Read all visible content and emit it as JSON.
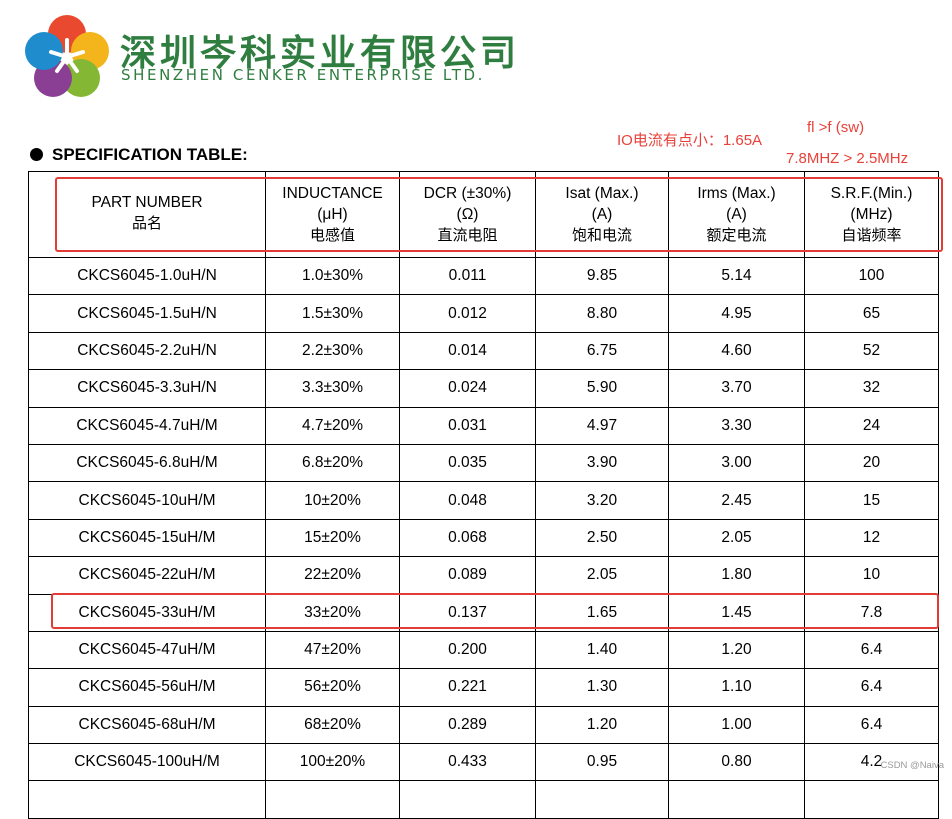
{
  "header": {
    "company_cn": "深圳岑科实业有限公司",
    "company_en": "SHENZHEN CENKER ENTERPRISE LTD."
  },
  "annotations": {
    "io_note": "IO电流有点小：1.65A",
    "freq_formula": "fl >f (sw)",
    "freq_compare": "7.8MHZ > 2.5MHz"
  },
  "spec_title": "SPECIFICATION TABLE:",
  "table": {
    "headers": [
      {
        "l1": "PART NUMBER",
        "l2": "",
        "cn": "品名"
      },
      {
        "l1": "INDUCTANCE",
        "l2": "(μH)",
        "cn": "电感值"
      },
      {
        "l1": "DCR (±30%)",
        "l2": "(Ω)",
        "cn": "直流电阻"
      },
      {
        "l1": "Isat (Max.)",
        "l2": "(A)",
        "cn": "饱和电流"
      },
      {
        "l1": "Irms (Max.)",
        "l2": "(A)",
        "cn": "额定电流"
      },
      {
        "l1": "S.R.F.(Min.)",
        "l2": "(MHz)",
        "cn": "自谐频率"
      }
    ],
    "rows": [
      [
        "CKCS6045-1.0uH/N",
        "1.0±30%",
        "0.011",
        "9.85",
        "5.14",
        "100"
      ],
      [
        "CKCS6045-1.5uH/N",
        "1.5±30%",
        "0.012",
        "8.80",
        "4.95",
        "65"
      ],
      [
        "CKCS6045-2.2uH/N",
        "2.2±30%",
        "0.014",
        "6.75",
        "4.60",
        "52"
      ],
      [
        "CKCS6045-3.3uH/N",
        "3.3±30%",
        "0.024",
        "5.90",
        "3.70",
        "32"
      ],
      [
        "CKCS6045-4.7uH/M",
        "4.7±20%",
        "0.031",
        "4.97",
        "3.30",
        "24"
      ],
      [
        "CKCS6045-6.8uH/M",
        "6.8±20%",
        "0.035",
        "3.90",
        "3.00",
        "20"
      ],
      [
        "CKCS6045-10uH/M",
        "10±20%",
        "0.048",
        "3.20",
        "2.45",
        "15"
      ],
      [
        "CKCS6045-15uH/M",
        "15±20%",
        "0.068",
        "2.50",
        "2.05",
        "12"
      ],
      [
        "CKCS6045-22uH/M",
        "22±20%",
        "0.089",
        "2.05",
        "1.80",
        "10"
      ],
      [
        "CKCS6045-33uH/M",
        "33±20%",
        "0.137",
        "1.65",
        "1.45",
        "7.8"
      ],
      [
        "CKCS6045-47uH/M",
        "47±20%",
        "0.200",
        "1.40",
        "1.20",
        "6.4"
      ],
      [
        "CKCS6045-56uH/M",
        "56±20%",
        "0.221",
        "1.30",
        "1.10",
        "6.4"
      ],
      [
        "CKCS6045-68uH/M",
        "68±20%",
        "0.289",
        "1.20",
        "1.00",
        "6.4"
      ],
      [
        "CKCS6045-100uH/M",
        "100±20%",
        "0.433",
        "0.95",
        "0.80",
        "4.2"
      ],
      [
        "",
        "",
        "",
        "",
        "",
        ""
      ]
    ]
  },
  "watermark": "CSDN @Naiva",
  "colors": {
    "brand_green": "#2f7e40",
    "highlight_red": "#e33b36",
    "annotation_red": "#e8413a"
  }
}
